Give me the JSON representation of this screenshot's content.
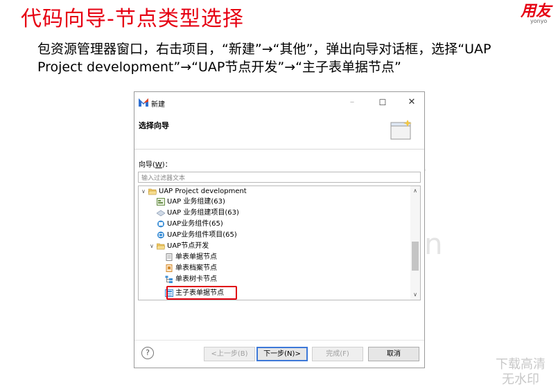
{
  "slide": {
    "title": "代码向导-节点类型选择",
    "description": "包资源管理器窗口，右击项目，“新建”→“其他”，弹出向导对话框，选择“UAP Project development”→“UAP节点开发”→“主子表单据节点”",
    "brand": "用友",
    "brand_sub": "yonyo",
    "watermark_line1": "下载高清",
    "watermark_line2": "无水印"
  },
  "dialog": {
    "window_title": "新建",
    "header_title": "选择向导",
    "filter_label": "向导(",
    "filter_key": "W",
    "filter_label_end": ")：",
    "filter_placeholder": "输入过滤器文本",
    "tree": [
      {
        "label": "UAP Project development",
        "icon": "folder-open-icon",
        "chevron": "˅"
      },
      {
        "label": "UAP 业务组建(63)",
        "icon": "component-icon"
      },
      {
        "label": "UAP 业务组建项目(63)",
        "icon": "project-icon"
      },
      {
        "label": "UAP业务组件(65)",
        "icon": "business-component-icon"
      },
      {
        "label": "UAP业务组件项目(65)",
        "icon": "business-project-icon"
      },
      {
        "label": "UAP节点开发",
        "icon": "folder-open-icon",
        "chevron": "˅"
      },
      {
        "label": "单表单据节点",
        "icon": "document-icon"
      },
      {
        "label": "单表档案节点",
        "icon": "archive-icon"
      },
      {
        "label": "单表树卡节点",
        "icon": "tree-card-icon"
      },
      {
        "label": "主子表单据节点",
        "icon": "master-detail-icon"
      }
    ],
    "buttons": {
      "back": "<上一步(B)",
      "next": "下一步(N)>",
      "finish": "完成(F)",
      "cancel": "取消"
    },
    "help": "?"
  },
  "colors": {
    "accent_red": "#e60012",
    "highlight_red": "#e0000e",
    "focus_blue": "#3c78d8"
  }
}
